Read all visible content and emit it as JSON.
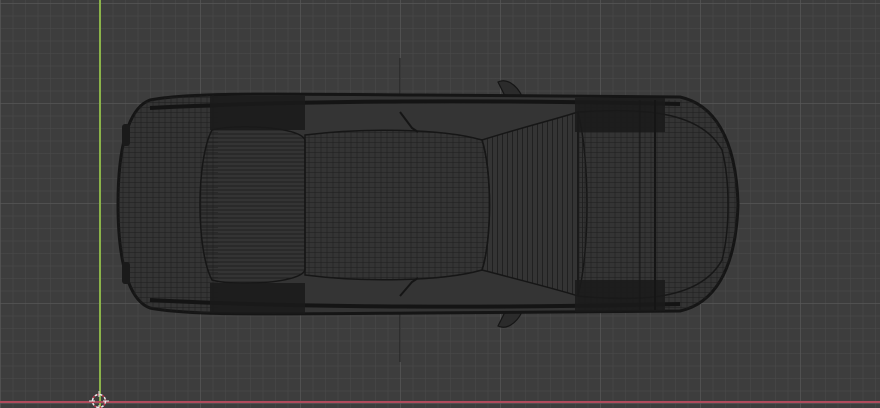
{
  "app": {
    "view": "top-orthographic",
    "mode": "wireframe"
  },
  "colors": {
    "background": "#3d3d3d",
    "grid_minor": "#484848",
    "grid_major": "#5a5a5a",
    "axis_y": "#8bb34a",
    "axis_x": "#b04a5c",
    "wire": "#1c1c1c",
    "wire_dense": "#141414",
    "cursor": "#e8e8e8",
    "cursor_accent": "#c0344a"
  },
  "icons": {
    "cursor": "3d-cursor-icon"
  },
  "object": {
    "kind": "car",
    "orientation": "top-down"
  }
}
